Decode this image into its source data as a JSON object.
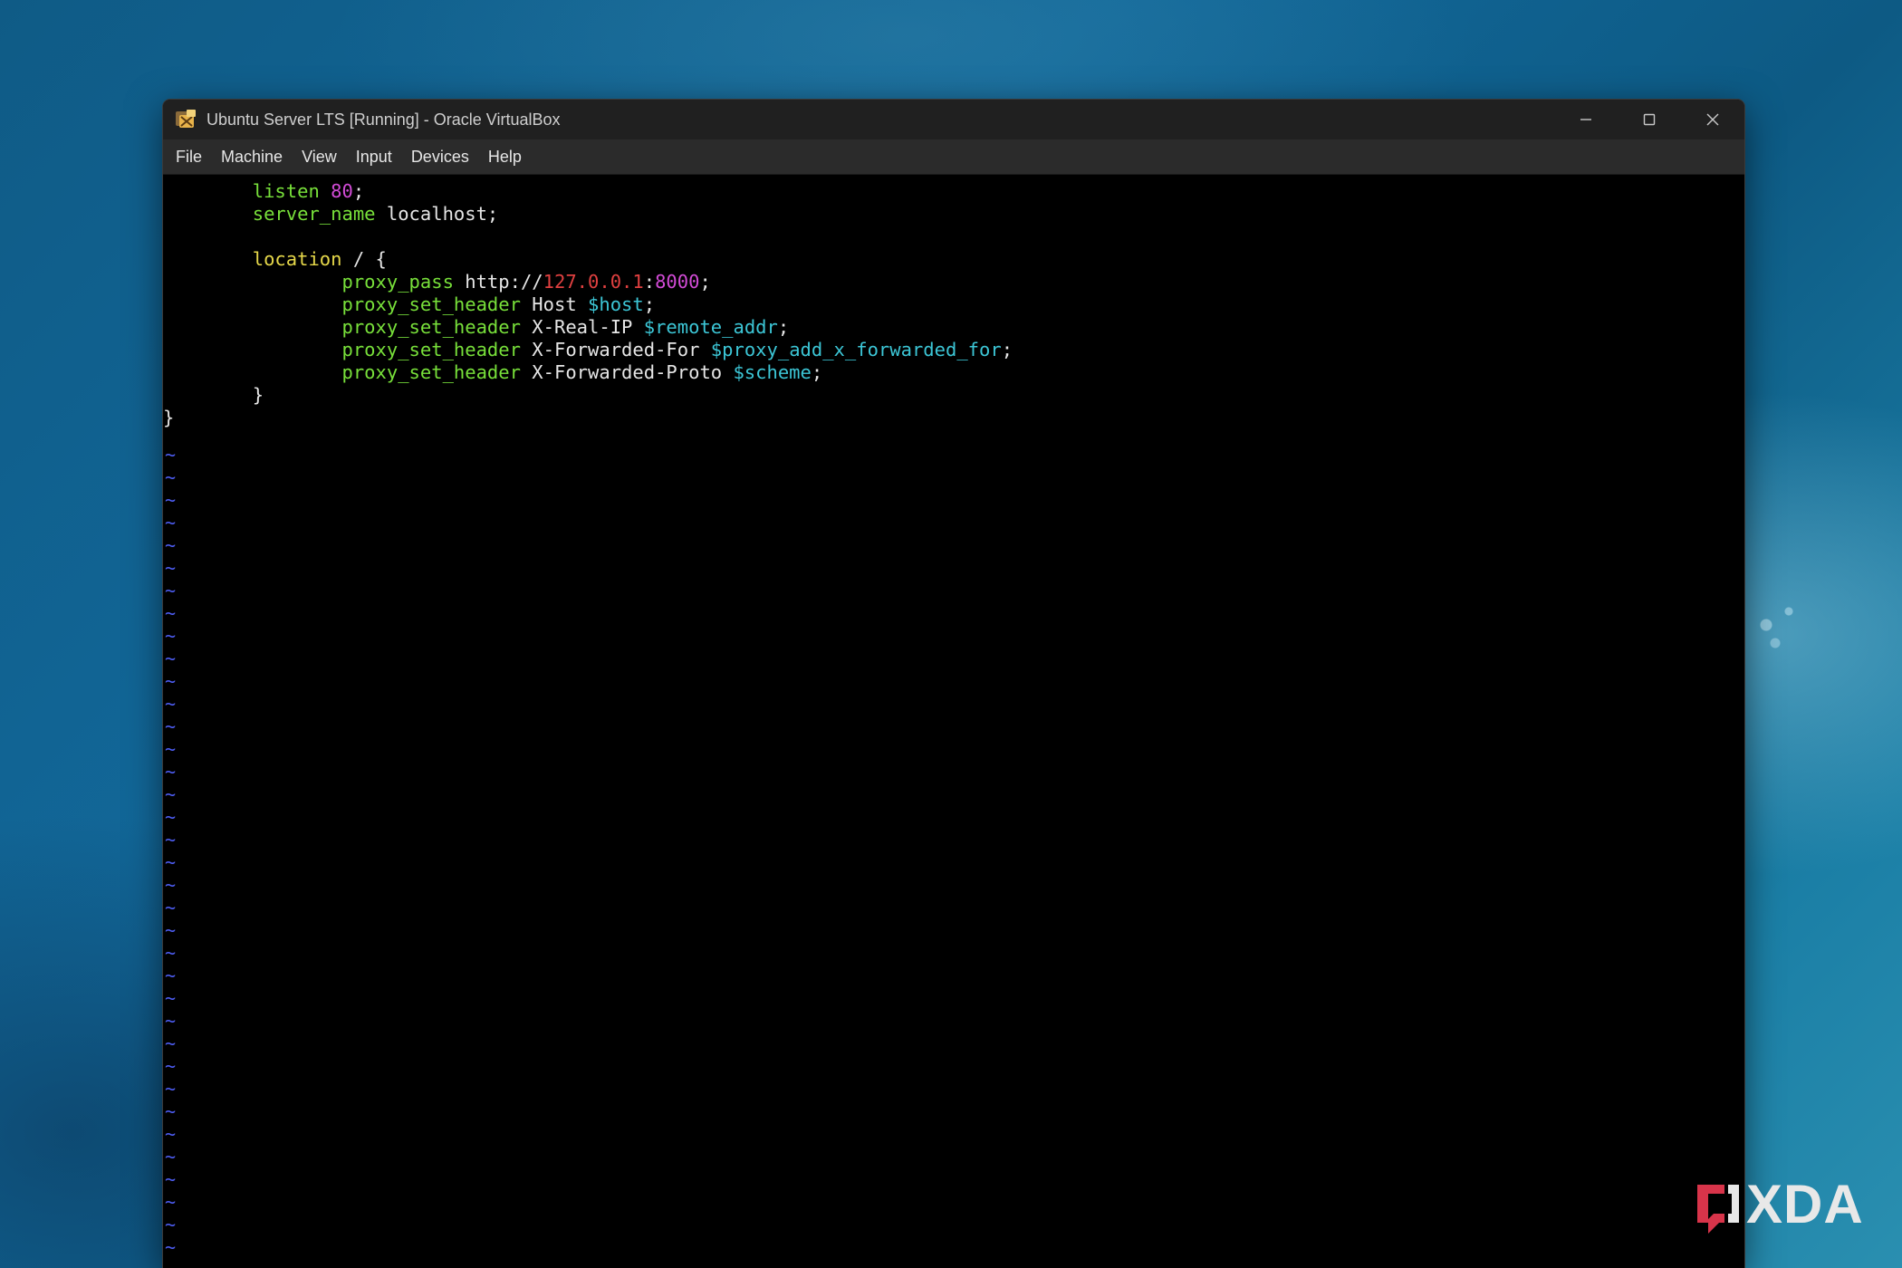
{
  "window": {
    "title": "Ubuntu Server LTS [Running] - Oracle VirtualBox"
  },
  "menu": {
    "items": [
      {
        "label": "File"
      },
      {
        "label": "Machine"
      },
      {
        "label": "View"
      },
      {
        "label": "Input"
      },
      {
        "label": "Devices"
      },
      {
        "label": "Help"
      }
    ]
  },
  "editor": {
    "lines": [
      [
        {
          "t": "        ",
          "c": "plain"
        },
        {
          "t": "listen",
          "c": "kw"
        },
        {
          "t": " ",
          "c": "plain"
        },
        {
          "t": "80",
          "c": "num"
        },
        {
          "t": ";",
          "c": "plain"
        }
      ],
      [
        {
          "t": "        ",
          "c": "plain"
        },
        {
          "t": "server_name",
          "c": "kw"
        },
        {
          "t": " localhost;",
          "c": "plain"
        }
      ],
      [],
      [
        {
          "t": "        ",
          "c": "plain"
        },
        {
          "t": "location",
          "c": "loc"
        },
        {
          "t": " / {",
          "c": "plain"
        }
      ],
      [
        {
          "t": "                ",
          "c": "plain"
        },
        {
          "t": "proxy_pass",
          "c": "kw"
        },
        {
          "t": " http://",
          "c": "plain"
        },
        {
          "t": "127.0.0.1",
          "c": "ip"
        },
        {
          "t": ":",
          "c": "plain"
        },
        {
          "t": "8000",
          "c": "num"
        },
        {
          "t": ";",
          "c": "plain"
        }
      ],
      [
        {
          "t": "                ",
          "c": "plain"
        },
        {
          "t": "proxy_set_header",
          "c": "kw"
        },
        {
          "t": " Host ",
          "c": "plain"
        },
        {
          "t": "$host",
          "c": "var"
        },
        {
          "t": ";",
          "c": "plain"
        }
      ],
      [
        {
          "t": "                ",
          "c": "plain"
        },
        {
          "t": "proxy_set_header",
          "c": "kw"
        },
        {
          "t": " X-Real-IP ",
          "c": "plain"
        },
        {
          "t": "$remote_addr",
          "c": "var"
        },
        {
          "t": ";",
          "c": "plain"
        }
      ],
      [
        {
          "t": "                ",
          "c": "plain"
        },
        {
          "t": "proxy_set_header",
          "c": "kw"
        },
        {
          "t": " X-Forwarded-For ",
          "c": "plain"
        },
        {
          "t": "$proxy_add_x_forwarded_for",
          "c": "var"
        },
        {
          "t": ";",
          "c": "plain"
        }
      ],
      [
        {
          "t": "                ",
          "c": "plain"
        },
        {
          "t": "proxy_set_header",
          "c": "kw"
        },
        {
          "t": " X-Forwarded-Proto ",
          "c": "plain"
        },
        {
          "t": "$scheme",
          "c": "var"
        },
        {
          "t": ";",
          "c": "plain"
        }
      ],
      [
        {
          "t": "        }",
          "c": "plain"
        }
      ],
      [
        {
          "t": "}",
          "c": "plain"
        }
      ]
    ],
    "empty_line_marker": "~"
  },
  "colors": {
    "directive": "#78e03a",
    "location": "#e6d84a",
    "number": "#d24bd6",
    "ip": "#e04040",
    "variable": "#3cc6d6",
    "tilde": "#4c5cf0"
  },
  "watermark": {
    "text": "XDA"
  }
}
